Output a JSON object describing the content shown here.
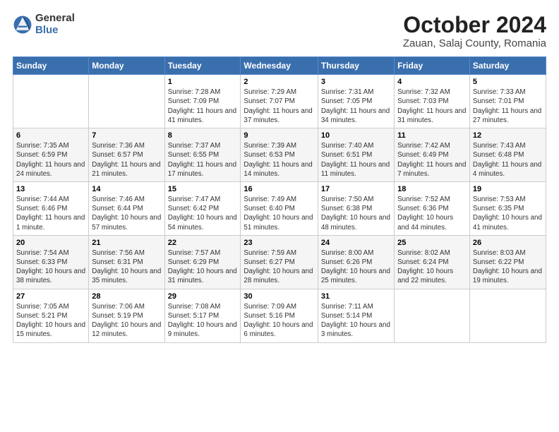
{
  "logo": {
    "general": "General",
    "blue": "Blue"
  },
  "header": {
    "month": "October 2024",
    "location": "Zauan, Salaj County, Romania"
  },
  "weekdays": [
    "Sunday",
    "Monday",
    "Tuesday",
    "Wednesday",
    "Thursday",
    "Friday",
    "Saturday"
  ],
  "weeks": [
    [
      {
        "day": "",
        "sunrise": "",
        "sunset": "",
        "daylight": ""
      },
      {
        "day": "",
        "sunrise": "",
        "sunset": "",
        "daylight": ""
      },
      {
        "day": "1",
        "sunrise": "Sunrise: 7:28 AM",
        "sunset": "Sunset: 7:09 PM",
        "daylight": "Daylight: 11 hours and 41 minutes."
      },
      {
        "day": "2",
        "sunrise": "Sunrise: 7:29 AM",
        "sunset": "Sunset: 7:07 PM",
        "daylight": "Daylight: 11 hours and 37 minutes."
      },
      {
        "day": "3",
        "sunrise": "Sunrise: 7:31 AM",
        "sunset": "Sunset: 7:05 PM",
        "daylight": "Daylight: 11 hours and 34 minutes."
      },
      {
        "day": "4",
        "sunrise": "Sunrise: 7:32 AM",
        "sunset": "Sunset: 7:03 PM",
        "daylight": "Daylight: 11 hours and 31 minutes."
      },
      {
        "day": "5",
        "sunrise": "Sunrise: 7:33 AM",
        "sunset": "Sunset: 7:01 PM",
        "daylight": "Daylight: 11 hours and 27 minutes."
      }
    ],
    [
      {
        "day": "6",
        "sunrise": "Sunrise: 7:35 AM",
        "sunset": "Sunset: 6:59 PM",
        "daylight": "Daylight: 11 hours and 24 minutes."
      },
      {
        "day": "7",
        "sunrise": "Sunrise: 7:36 AM",
        "sunset": "Sunset: 6:57 PM",
        "daylight": "Daylight: 11 hours and 21 minutes."
      },
      {
        "day": "8",
        "sunrise": "Sunrise: 7:37 AM",
        "sunset": "Sunset: 6:55 PM",
        "daylight": "Daylight: 11 hours and 17 minutes."
      },
      {
        "day": "9",
        "sunrise": "Sunrise: 7:39 AM",
        "sunset": "Sunset: 6:53 PM",
        "daylight": "Daylight: 11 hours and 14 minutes."
      },
      {
        "day": "10",
        "sunrise": "Sunrise: 7:40 AM",
        "sunset": "Sunset: 6:51 PM",
        "daylight": "Daylight: 11 hours and 11 minutes."
      },
      {
        "day": "11",
        "sunrise": "Sunrise: 7:42 AM",
        "sunset": "Sunset: 6:49 PM",
        "daylight": "Daylight: 11 hours and 7 minutes."
      },
      {
        "day": "12",
        "sunrise": "Sunrise: 7:43 AM",
        "sunset": "Sunset: 6:48 PM",
        "daylight": "Daylight: 11 hours and 4 minutes."
      }
    ],
    [
      {
        "day": "13",
        "sunrise": "Sunrise: 7:44 AM",
        "sunset": "Sunset: 6:46 PM",
        "daylight": "Daylight: 11 hours and 1 minute."
      },
      {
        "day": "14",
        "sunrise": "Sunrise: 7:46 AM",
        "sunset": "Sunset: 6:44 PM",
        "daylight": "Daylight: 10 hours and 57 minutes."
      },
      {
        "day": "15",
        "sunrise": "Sunrise: 7:47 AM",
        "sunset": "Sunset: 6:42 PM",
        "daylight": "Daylight: 10 hours and 54 minutes."
      },
      {
        "day": "16",
        "sunrise": "Sunrise: 7:49 AM",
        "sunset": "Sunset: 6:40 PM",
        "daylight": "Daylight: 10 hours and 51 minutes."
      },
      {
        "day": "17",
        "sunrise": "Sunrise: 7:50 AM",
        "sunset": "Sunset: 6:38 PM",
        "daylight": "Daylight: 10 hours and 48 minutes."
      },
      {
        "day": "18",
        "sunrise": "Sunrise: 7:52 AM",
        "sunset": "Sunset: 6:36 PM",
        "daylight": "Daylight: 10 hours and 44 minutes."
      },
      {
        "day": "19",
        "sunrise": "Sunrise: 7:53 AM",
        "sunset": "Sunset: 6:35 PM",
        "daylight": "Daylight: 10 hours and 41 minutes."
      }
    ],
    [
      {
        "day": "20",
        "sunrise": "Sunrise: 7:54 AM",
        "sunset": "Sunset: 6:33 PM",
        "daylight": "Daylight: 10 hours and 38 minutes."
      },
      {
        "day": "21",
        "sunrise": "Sunrise: 7:56 AM",
        "sunset": "Sunset: 6:31 PM",
        "daylight": "Daylight: 10 hours and 35 minutes."
      },
      {
        "day": "22",
        "sunrise": "Sunrise: 7:57 AM",
        "sunset": "Sunset: 6:29 PM",
        "daylight": "Daylight: 10 hours and 31 minutes."
      },
      {
        "day": "23",
        "sunrise": "Sunrise: 7:59 AM",
        "sunset": "Sunset: 6:27 PM",
        "daylight": "Daylight: 10 hours and 28 minutes."
      },
      {
        "day": "24",
        "sunrise": "Sunrise: 8:00 AM",
        "sunset": "Sunset: 6:26 PM",
        "daylight": "Daylight: 10 hours and 25 minutes."
      },
      {
        "day": "25",
        "sunrise": "Sunrise: 8:02 AM",
        "sunset": "Sunset: 6:24 PM",
        "daylight": "Daylight: 10 hours and 22 minutes."
      },
      {
        "day": "26",
        "sunrise": "Sunrise: 8:03 AM",
        "sunset": "Sunset: 6:22 PM",
        "daylight": "Daylight: 10 hours and 19 minutes."
      }
    ],
    [
      {
        "day": "27",
        "sunrise": "Sunrise: 7:05 AM",
        "sunset": "Sunset: 5:21 PM",
        "daylight": "Daylight: 10 hours and 15 minutes."
      },
      {
        "day": "28",
        "sunrise": "Sunrise: 7:06 AM",
        "sunset": "Sunset: 5:19 PM",
        "daylight": "Daylight: 10 hours and 12 minutes."
      },
      {
        "day": "29",
        "sunrise": "Sunrise: 7:08 AM",
        "sunset": "Sunset: 5:17 PM",
        "daylight": "Daylight: 10 hours and 9 minutes."
      },
      {
        "day": "30",
        "sunrise": "Sunrise: 7:09 AM",
        "sunset": "Sunset: 5:16 PM",
        "daylight": "Daylight: 10 hours and 6 minutes."
      },
      {
        "day": "31",
        "sunrise": "Sunrise: 7:11 AM",
        "sunset": "Sunset: 5:14 PM",
        "daylight": "Daylight: 10 hours and 3 minutes."
      },
      {
        "day": "",
        "sunrise": "",
        "sunset": "",
        "daylight": ""
      },
      {
        "day": "",
        "sunrise": "",
        "sunset": "",
        "daylight": ""
      }
    ]
  ]
}
